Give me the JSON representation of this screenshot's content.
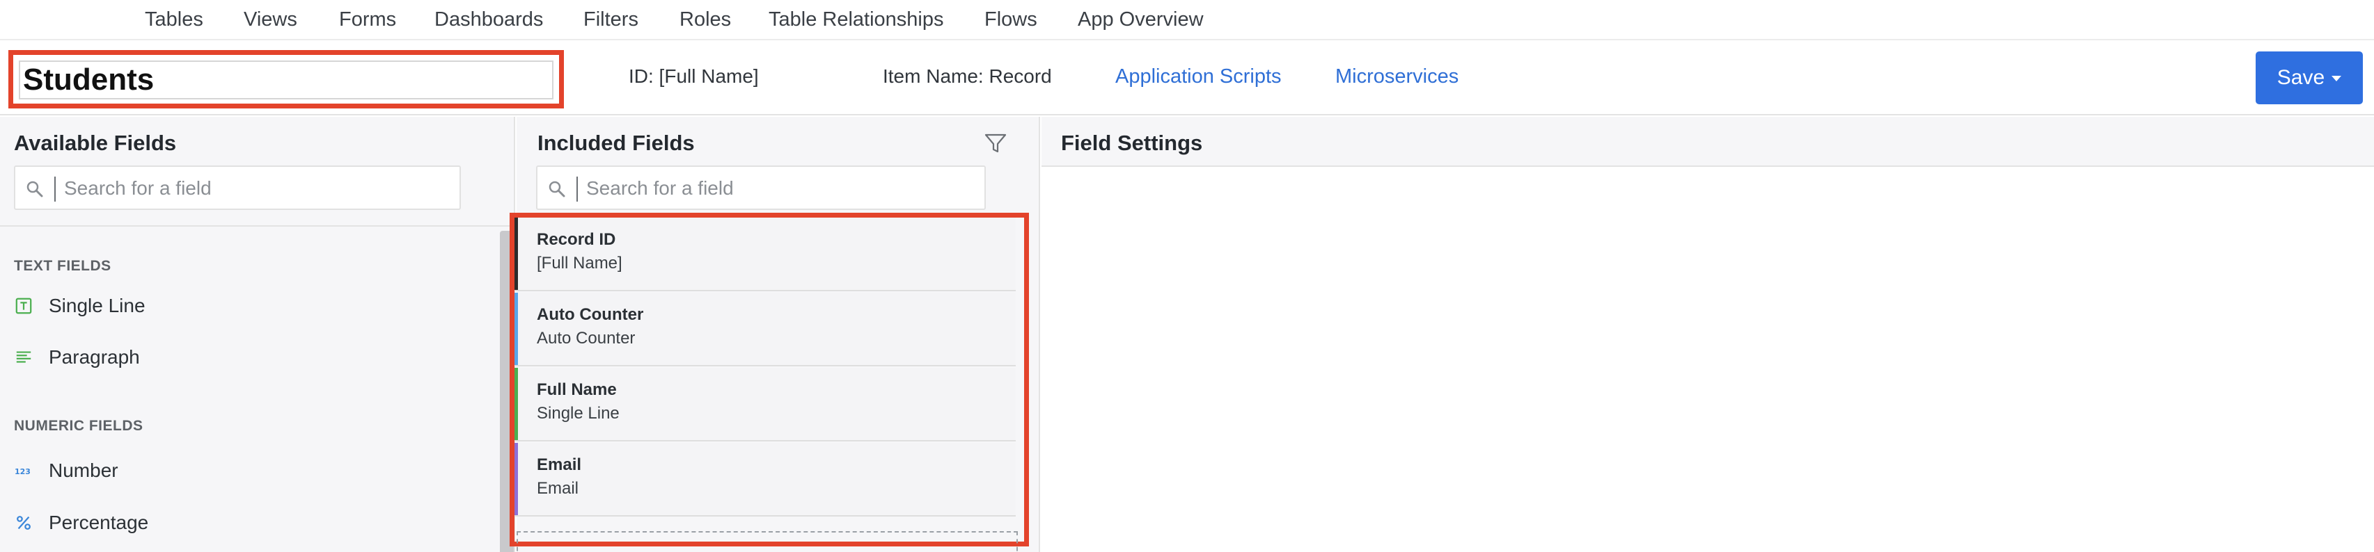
{
  "nav": {
    "items": [
      "Tables",
      "Views",
      "Forms",
      "Dashboards",
      "Filters",
      "Roles",
      "Table Relationships",
      "Flows",
      "App Overview"
    ]
  },
  "header": {
    "table_name": "Students",
    "id_label": "ID: [Full Name]",
    "item_name_label": "Item Name: Record",
    "application_scripts": "Application Scripts",
    "microservices": "Microservices",
    "save_label": "Save"
  },
  "available": {
    "title": "Available Fields",
    "search_placeholder": "Search for a field",
    "sections": [
      {
        "heading": "TEXT FIELDS",
        "items": [
          {
            "label": "Single Line",
            "icon": "single-line-icon"
          },
          {
            "label": "Paragraph",
            "icon": "paragraph-icon"
          }
        ]
      },
      {
        "heading": "NUMERIC FIELDS",
        "items": [
          {
            "label": "Number",
            "icon": "number-icon"
          },
          {
            "label": "Percentage",
            "icon": "percentage-icon"
          }
        ]
      }
    ]
  },
  "included": {
    "title": "Included Fields",
    "search_placeholder": "Search for a field",
    "fields": [
      {
        "name": "Record ID",
        "type": "[Full Name]",
        "color": "#2b2b2b"
      },
      {
        "name": "Auto Counter",
        "type": "Auto Counter",
        "color": "#5aa6e8"
      },
      {
        "name": "Full Name",
        "type": "Single Line",
        "color": "#4caf50"
      },
      {
        "name": "Email",
        "type": "Email",
        "color": "#8e6fd6"
      }
    ]
  },
  "settings": {
    "title": "Field Settings"
  },
  "colors": {
    "accent": "#2f6fe0",
    "highlight": "#e3432b",
    "link": "#2f6fd6"
  }
}
